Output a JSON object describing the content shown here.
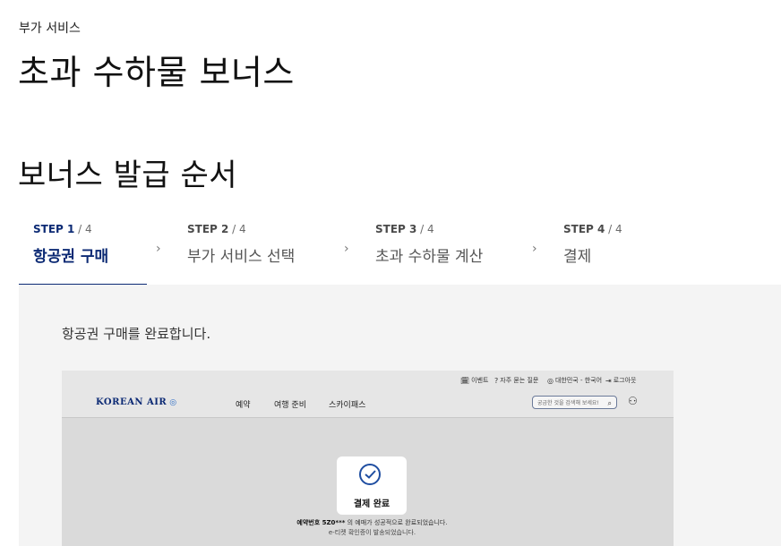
{
  "header": {
    "eyebrow": "부가 서비스",
    "title": "초과 수하물 보너스"
  },
  "section": {
    "title": "보너스 발급 순서"
  },
  "steps": [
    {
      "prefix": "STEP 1",
      "total": " / 4",
      "label": "항공권 구매",
      "active": true
    },
    {
      "prefix": "STEP 2",
      "total": " / 4",
      "label": "부가 서비스 선택",
      "active": false
    },
    {
      "prefix": "STEP 3",
      "total": " / 4",
      "label": "초과 수하물 계산",
      "active": false
    },
    {
      "prefix": "STEP 4",
      "total": " / 4",
      "label": "결제",
      "active": false
    }
  ],
  "chevron": "›",
  "panel": {
    "message": "항공권 구매를 완료합니다."
  },
  "screenshot": {
    "utility": [
      {
        "icon": "🗓",
        "label": "이벤트"
      },
      {
        "icon": "?",
        "label": "자주 묻는 질문"
      },
      {
        "icon": "◎",
        "label": "대한민국 - 한국어"
      },
      {
        "icon": "⇥",
        "label": "로그아웃"
      }
    ],
    "logo": "KOREAN AIR",
    "logo_mark": "◎",
    "nav": [
      "예약",
      "여행 준비",
      "스카이패스"
    ],
    "search_placeholder": "궁금한 것을 검색해 보세요!",
    "search_icon": "⌕",
    "user_icon": "⚇",
    "card_label": "결제 완료",
    "confirm_prefix": "예약번호 5Z0***",
    "confirm_rest": " 의 예매가 성공적으로 완료되었습니다.",
    "confirm_line2": "e-티켓 확인증이 발송되었습니다."
  }
}
